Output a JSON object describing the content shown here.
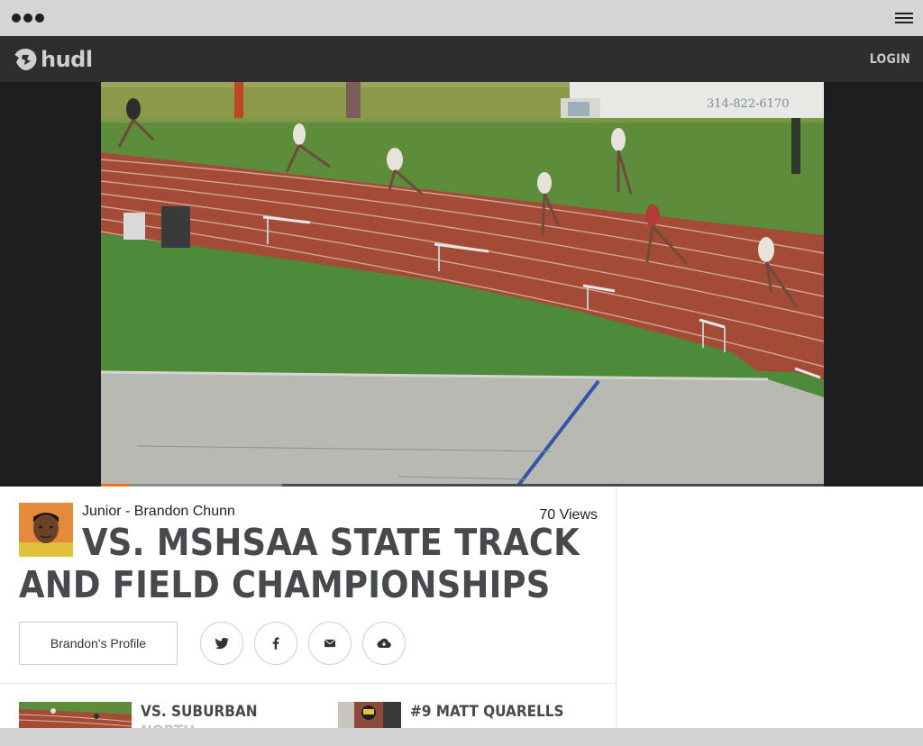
{
  "header": {
    "logo_text": "hudl",
    "login_label": "LOGIN"
  },
  "video": {
    "progress_fraction": 0.04,
    "buffered_fraction": 0.25,
    "truck_text": "314-822-6170"
  },
  "athlete": {
    "label": "Junior - Brandon Chunn",
    "views": "70 Views"
  },
  "highlight": {
    "title": "VS. MSHSAA STATE TRACK AND FIELD CHAMPIONSHIPS"
  },
  "actions": {
    "profile_label": "Brandon's Profile",
    "share_icons": [
      "twitter-icon",
      "facebook-icon",
      "email-icon",
      "download-icon"
    ]
  },
  "related": [
    {
      "title": "VS. SUBURBAN",
      "subtitle": "NORTH"
    },
    {
      "title": "#9 MATT QUARELLS",
      "subtitle": ""
    }
  ],
  "colors": {
    "header_bg": "#2e2e30",
    "accent": "#f37021",
    "title": "#47494c"
  }
}
